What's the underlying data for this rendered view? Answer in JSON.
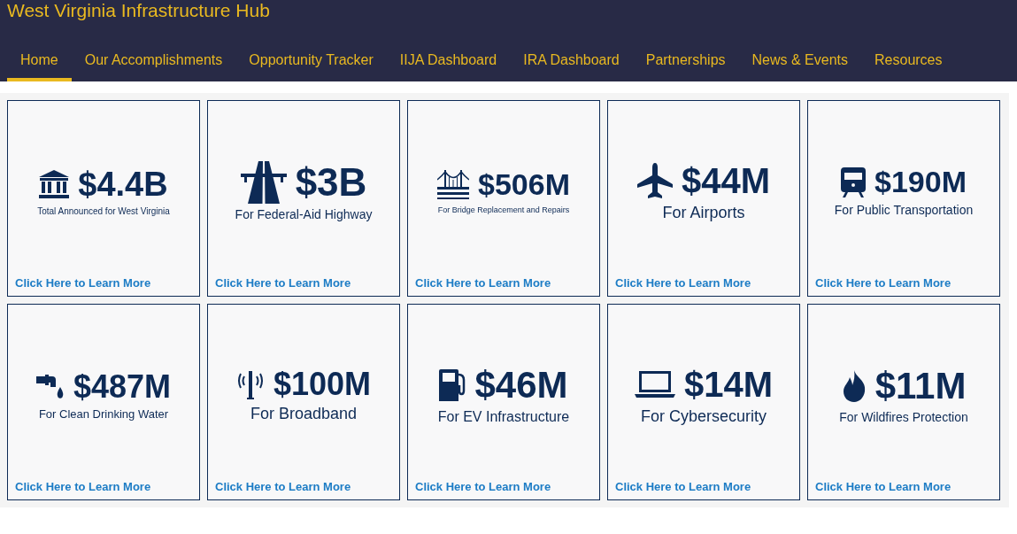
{
  "header": {
    "title": "West Virginia Infrastructure Hub"
  },
  "nav": [
    {
      "label": "Home",
      "selected": true
    },
    {
      "label": "Our Accomplishments",
      "selected": false
    },
    {
      "label": "Opportunity Tracker",
      "selected": false
    },
    {
      "label": "IIJA Dashboard",
      "selected": false
    },
    {
      "label": "IRA Dashboard",
      "selected": false
    },
    {
      "label": "Partnerships",
      "selected": false
    },
    {
      "label": "News & Events",
      "selected": false
    },
    {
      "label": "Resources",
      "selected": false
    }
  ],
  "cards": [
    {
      "kind": "bank",
      "amount": "$4.4B",
      "caption": "Total Announced for West Virginia",
      "link": "Click Here to Learn More"
    },
    {
      "kind": "highway",
      "amount": "$3B",
      "caption": "For Federal-Aid Highway",
      "link": "Click Here to Learn More"
    },
    {
      "kind": "bridge",
      "amount": "$506M",
      "caption": "For Bridge Replacement and Repairs",
      "link": "Click Here to Learn More"
    },
    {
      "kind": "airplane",
      "amount": "$44M",
      "caption": "For Airports",
      "link": "Click Here to Learn More"
    },
    {
      "kind": "train",
      "amount": "$190M",
      "caption": "For Public Transportation",
      "link": "Click Here to Learn More"
    },
    {
      "kind": "water",
      "amount": "$487M",
      "caption": "For Clean Drinking Water",
      "link": "Click Here to Learn More"
    },
    {
      "kind": "tower",
      "amount": "$100M",
      "caption": "For Broadband",
      "link": "Click Here to Learn More"
    },
    {
      "kind": "fuel",
      "amount": "$46M",
      "caption": "For EV Infrastructure",
      "link": "Click Here to Learn More"
    },
    {
      "kind": "laptop",
      "amount": "$14M",
      "caption": "For Cybersecurity",
      "link": "Click Here to Learn More"
    },
    {
      "kind": "flame",
      "amount": "$11M",
      "caption": "For Wildfires Protection",
      "link": "Click Here to Learn More"
    }
  ]
}
